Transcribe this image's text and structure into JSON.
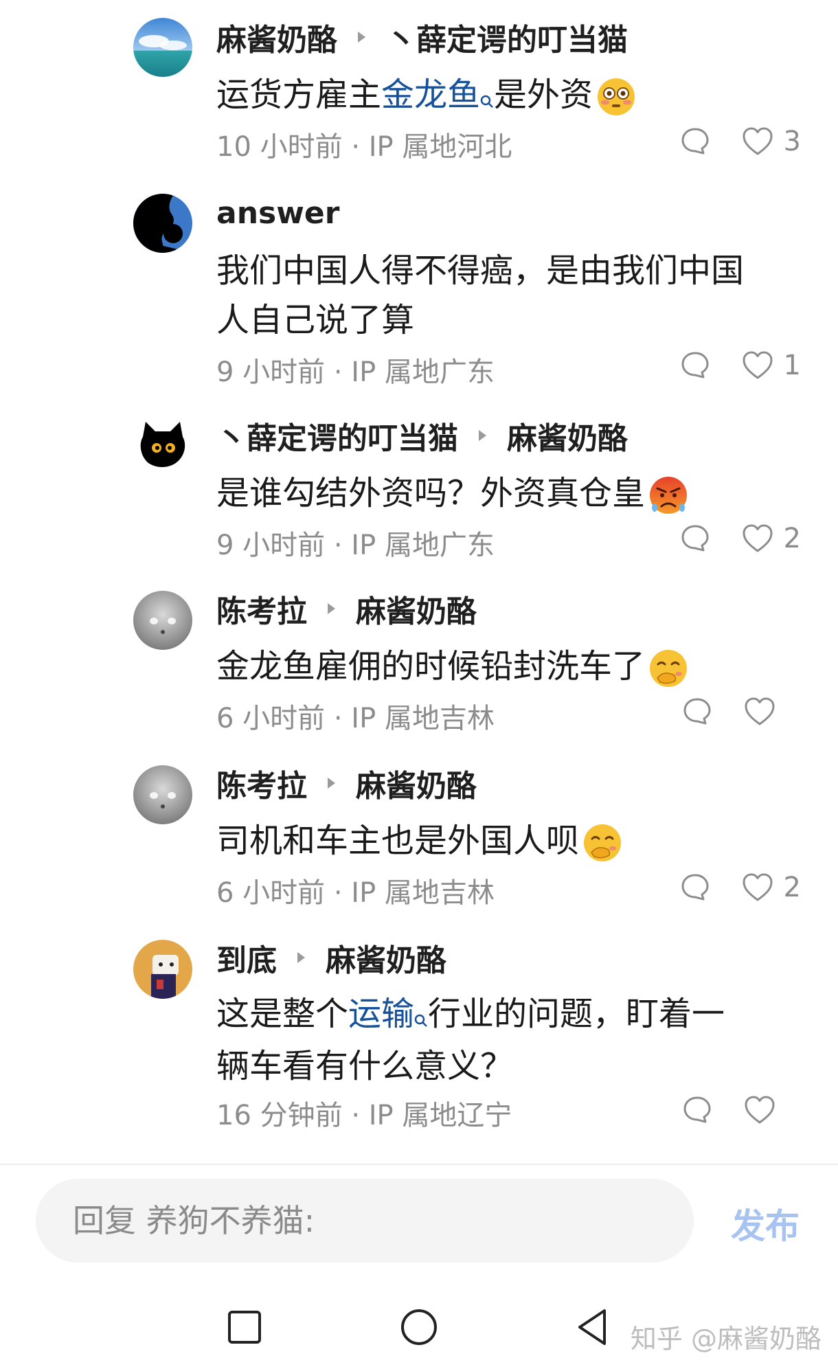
{
  "comments": [
    {
      "author": "麻酱奶酪",
      "reply_to": "丶薛定谔的叮当猫",
      "text_parts": [
        {
          "text": "运货方雇主"
        },
        {
          "text": "金龙鱼",
          "link": true
        },
        {
          "text": "是外资"
        }
      ],
      "emoji": "flushed-face-icon",
      "time_location": "10 小时前 · IP 属地河北",
      "likes": "3"
    },
    {
      "author": "answer",
      "text_lines": [
        "我们中国人得不得癌，是由我们中国",
        "人自己说了算"
      ],
      "time_location": "9 小时前 · IP 属地广东",
      "likes": "1"
    },
    {
      "author": "丶薛定谔的叮当猫",
      "reply_to": "麻酱奶酪",
      "text": "是谁勾结外资吗？外资真仓皇",
      "emoji": "angry-face-icon",
      "time_location": "9 小时前 · IP 属地广东",
      "likes": "2"
    },
    {
      "author": "陈考拉",
      "reply_to": "麻酱奶酪",
      "text": "金龙鱼雇佣的时候铅封洗车了",
      "emoji": "hand-over-mouth-icon",
      "time_location": "6 小时前 · IP 属地吉林",
      "likes": ""
    },
    {
      "author": "陈考拉",
      "reply_to": "麻酱奶酪",
      "text": "司机和车主也是外国人呗",
      "emoji": "hand-over-mouth-icon",
      "time_location": "6 小时前 · IP 属地吉林",
      "likes": "2"
    },
    {
      "author": "到底",
      "reply_to": "麻酱奶酪",
      "text_line1_parts": [
        {
          "text": "这是整个"
        },
        {
          "text": "运输",
          "link": true
        },
        {
          "text": "行业的问题，盯着一"
        }
      ],
      "text_line2": "辆车看有什么意义？",
      "time_location": "16 分钟前 · IP 属地辽宁",
      "likes": ""
    }
  ],
  "reply": {
    "placeholder": "回复 养狗不养猫:",
    "publish_label": "发布",
    "publish_color": "#a6c3f2"
  },
  "navbar": {
    "icons": [
      "square-recent-icon",
      "circle-home-icon",
      "triangle-back-icon"
    ]
  },
  "watermark": "知乎 @麻酱奶酪",
  "colors": {
    "link": "#175199",
    "meta": "#8c8c8c"
  }
}
